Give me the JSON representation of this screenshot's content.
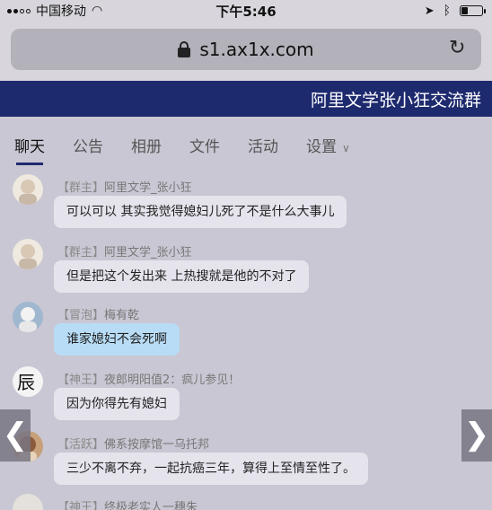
{
  "status_bar": {
    "carrier": "中国移动",
    "time": "下午5:46"
  },
  "browser": {
    "url": "s1.ax1x.com"
  },
  "group": {
    "title": "阿里文学张小狂交流群"
  },
  "tabs": [
    {
      "label": "聊天"
    },
    {
      "label": "公告"
    },
    {
      "label": "相册"
    },
    {
      "label": "文件"
    },
    {
      "label": "活动"
    },
    {
      "label": "设置"
    }
  ],
  "messages": [
    {
      "role": "【群主】",
      "name": "阿里文学_张小狂",
      "text": "可以可以  其实我觉得媳妇儿死了不是什么大事儿",
      "bubble": "gray"
    },
    {
      "role": "【群主】",
      "name": "阿里文学_张小狂",
      "text": "但是把这个发出来  上热搜就是他的不对了",
      "bubble": "gray"
    },
    {
      "role": "【冒泡】",
      "name": "梅有乾",
      "text": "谁家媳妇不会死啊",
      "bubble": "blue"
    },
    {
      "role": "【神王】",
      "name": "夜郎明阳值2：疯儿参见！",
      "text": "因为你得先有媳妇",
      "bubble": "gray"
    },
    {
      "role": "【活跃】",
      "name": "佛系按摩馆一乌托邦",
      "text": "三少不离不弃，一起抗癌三年，算得上至情至性了。",
      "bubble": "gray"
    },
    {
      "role": "【神王】",
      "name": "终极老实人一穗朱",
      "text": "",
      "bubble": "gray"
    }
  ],
  "colors": {
    "header_bg": "#1e2a6e",
    "chat_bg": "#c9c7d3",
    "bubble_gray": "#e5e3ec",
    "bubble_blue": "#b8dcf5"
  }
}
